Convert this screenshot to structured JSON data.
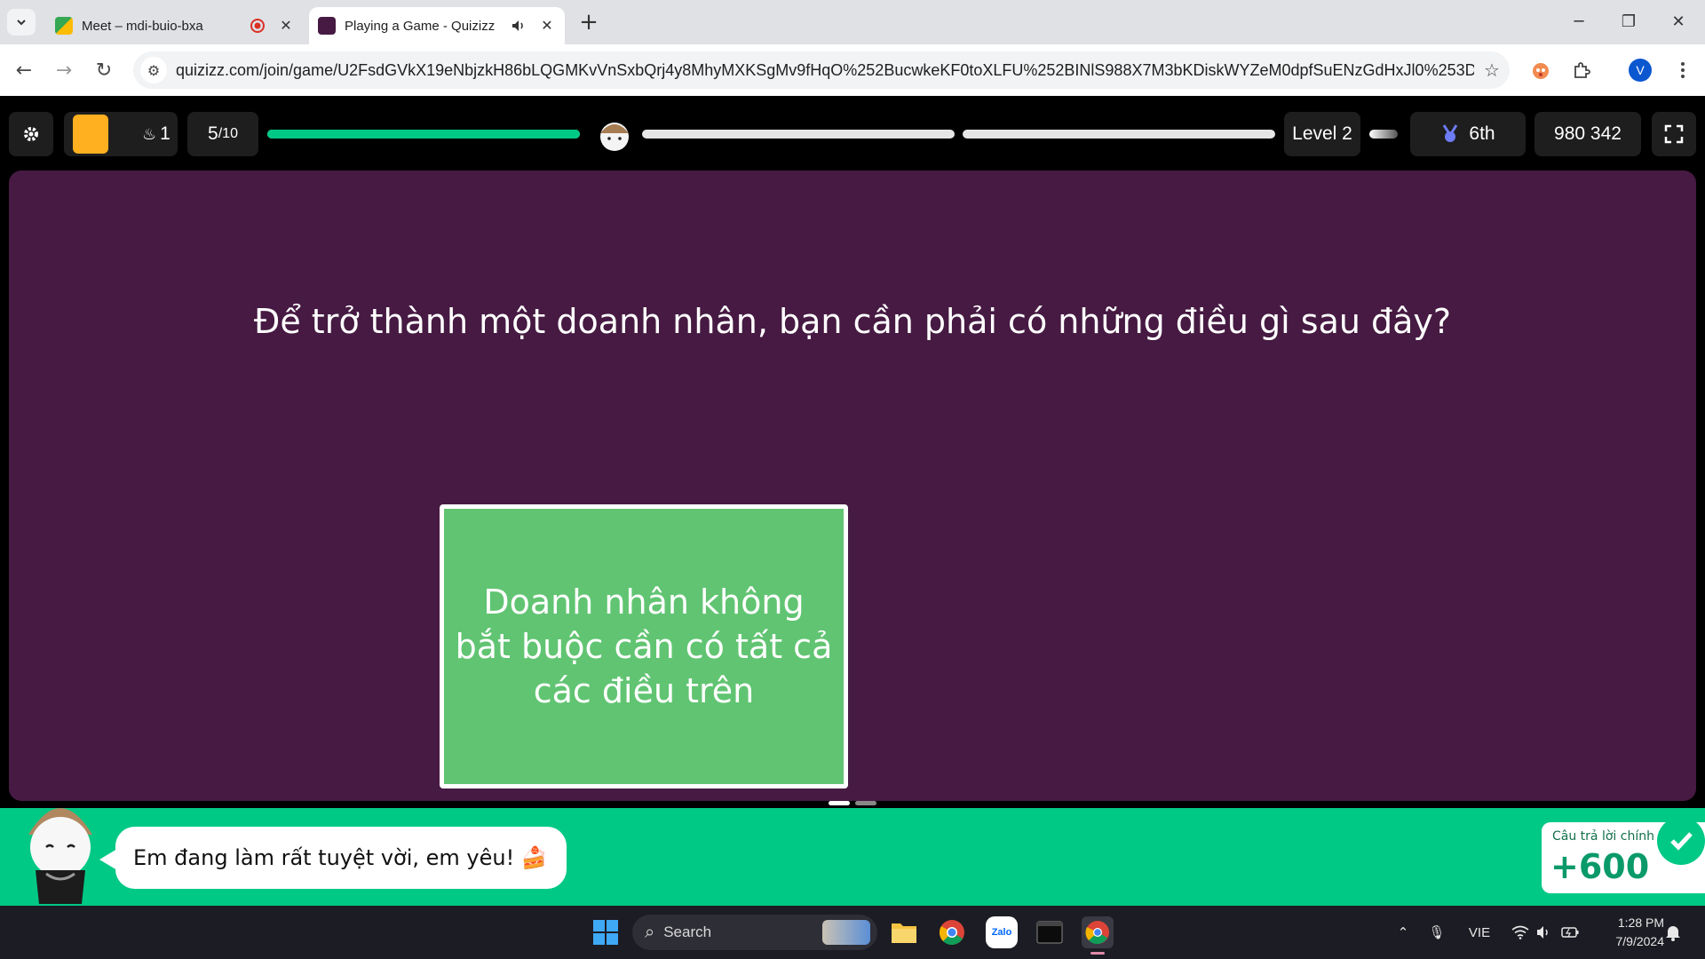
{
  "browser": {
    "tabs": [
      {
        "title": "Meet – mdi-buio-bxa",
        "active": false
      },
      {
        "title": "Playing a Game - Quizizz",
        "active": true
      }
    ],
    "url": "quizizz.com/join/game/U2FsdGVkX19eNbjzkH86bLQGMKvVnSxbQrj4y8MhyMXKSgMv9fHqO%252BucwkeKF0toXLFU%252BINlS988X7M3bKDiskWYZeM0dpfSuENzGdHxJl0%253D?gameTy...",
    "profile_initial": "V"
  },
  "game": {
    "streak": "1",
    "question_progress": "5/10",
    "question_current": "5",
    "question_total": "/10",
    "level": "Level 2",
    "rank": "6th",
    "score": "980 342",
    "progress_segment_1_fill": 1.0,
    "progress_segment_2_fill": 0.0,
    "progress_segment_3_fill": 0.0
  },
  "question": {
    "text": "Để trở thành một doanh nhân, bạn cần phải có những điều gì sau đây?",
    "option": "Doanh nhân không bắt buộc cần có tất cả các điều trên"
  },
  "feedback": {
    "message": "Em đang làm rất tuyệt vời, em yêu! 🍰",
    "label": "Câu trả lời chính",
    "points": "+600"
  },
  "taskbar": {
    "search": "Search",
    "language": "VIE",
    "time": "1:28 PM",
    "date": "7/9/2024"
  }
}
